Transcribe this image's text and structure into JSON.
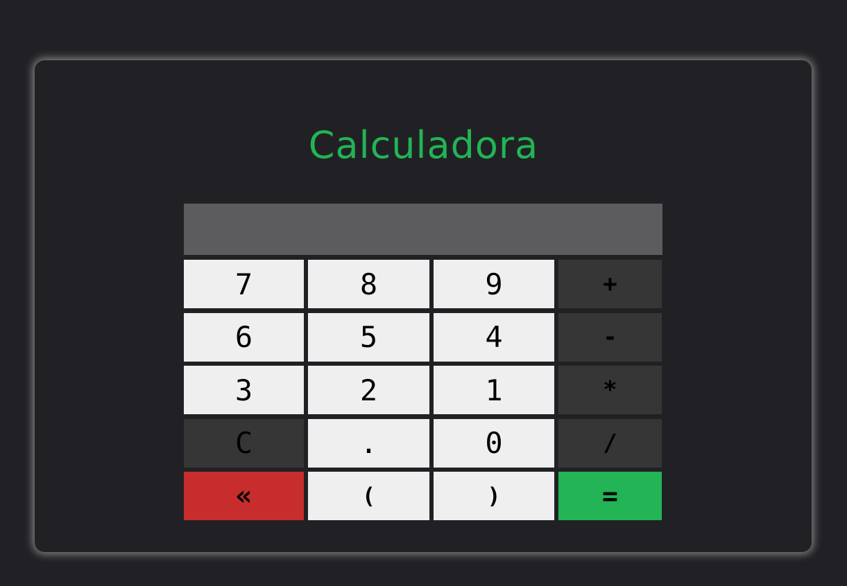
{
  "app": {
    "title": "Calculadora"
  },
  "display": {
    "value": ""
  },
  "keys": [
    {
      "label": "7",
      "name": "key-7",
      "kind": "digit"
    },
    {
      "label": "8",
      "name": "key-8",
      "kind": "digit"
    },
    {
      "label": "9",
      "name": "key-9",
      "kind": "digit"
    },
    {
      "label": "+",
      "name": "key-plus",
      "kind": "op"
    },
    {
      "label": "6",
      "name": "key-6",
      "kind": "digit"
    },
    {
      "label": "5",
      "name": "key-5",
      "kind": "digit"
    },
    {
      "label": "4",
      "name": "key-4",
      "kind": "digit"
    },
    {
      "label": "-",
      "name": "key-minus",
      "kind": "op"
    },
    {
      "label": "3",
      "name": "key-3",
      "kind": "digit"
    },
    {
      "label": "2",
      "name": "key-2",
      "kind": "digit"
    },
    {
      "label": "1",
      "name": "key-1",
      "kind": "digit"
    },
    {
      "label": "*",
      "name": "key-multiply",
      "kind": "op"
    },
    {
      "label": "C",
      "name": "key-clear",
      "kind": "clear"
    },
    {
      "label": ".",
      "name": "key-decimal",
      "kind": "digit"
    },
    {
      "label": "0",
      "name": "key-0",
      "kind": "digit"
    },
    {
      "label": "/",
      "name": "key-divide",
      "kind": "op"
    },
    {
      "label": "«",
      "name": "key-backspace",
      "kind": "back"
    },
    {
      "label": "(",
      "name": "key-open-paren",
      "kind": "paren"
    },
    {
      "label": ")",
      "name": "key-close-paren",
      "kind": "paren"
    },
    {
      "label": "=",
      "name": "key-equals",
      "kind": "equals"
    }
  ],
  "colors": {
    "background": "#212125",
    "accent": "#22b455",
    "display": "#5c5c5e",
    "key": "#efefef",
    "operator_key": "#363637",
    "backspace_key": "#c72d2d",
    "equals_key": "#22b455"
  }
}
